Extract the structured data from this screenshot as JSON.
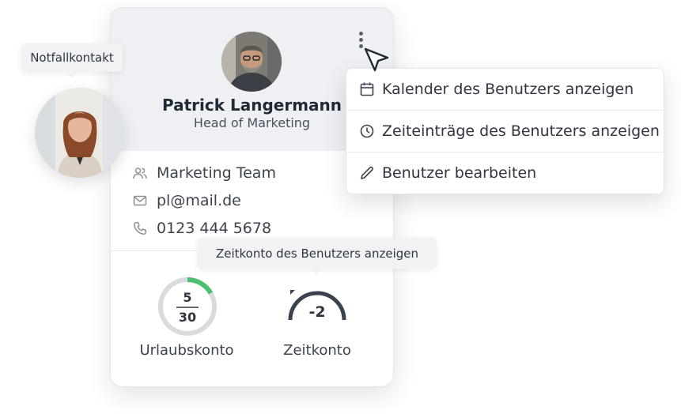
{
  "emergency": {
    "tooltip": "Notfallkontakt"
  },
  "profile": {
    "name": "Patrick Langermann",
    "role": "Head of Marketing",
    "team": "Marketing Team",
    "email": "pl@mail.de",
    "phone": "0123 444 5678"
  },
  "menu": {
    "items": [
      {
        "label": "Kalender des Benutzers anzeigen",
        "icon": "calendar-icon"
      },
      {
        "label": "Zeiteinträge des Benutzers anzeigen",
        "icon": "clock-icon"
      },
      {
        "label": "Benutzer bearbeiten",
        "icon": "pencil-icon"
      }
    ]
  },
  "zeitkonto_tooltip": "Zeitkonto des Benutzers anzeigen",
  "urlaubskonto": {
    "label": "Urlaubskonto",
    "used": "5",
    "total": "30",
    "progress": 0.1667,
    "color": "#4cbf73"
  },
  "zeitkonto": {
    "label": "Zeitkonto",
    "value": "-2"
  },
  "colors": {
    "accent_green": "#4cbf73",
    "header_bg": "#eef0f4",
    "text_dark": "#1f2a36"
  }
}
